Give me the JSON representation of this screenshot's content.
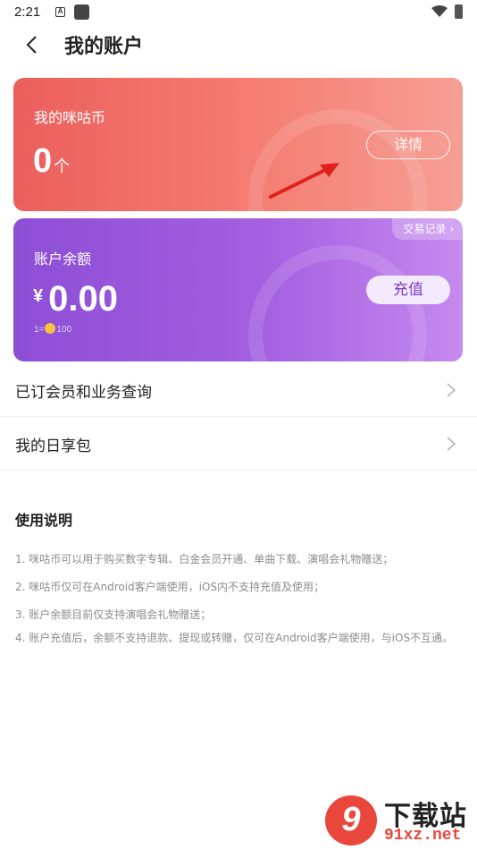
{
  "status_bar": {
    "time": "2:21",
    "notification_letter": "A"
  },
  "header": {
    "title": "我的账户"
  },
  "coin_card": {
    "label": "我的咪咕币",
    "amount": "0",
    "unit": "个",
    "detail_button": "详情"
  },
  "balance_card": {
    "transactions_link": "交易记录 ›",
    "label": "账户余额",
    "currency_symbol": "¥",
    "amount": "0.00",
    "rate_left": "1=",
    "rate_right": "100",
    "recharge_button": "充值"
  },
  "menu": {
    "items": [
      {
        "label": "已订会员和业务查询"
      },
      {
        "label": "我的日享包"
      }
    ]
  },
  "instructions": {
    "title": "使用说明",
    "notes": [
      "1. 咪咕币可以用于购买数字专辑、白金会员开通、单曲下载、演唱会礼物赠送；",
      "2. 咪咕币仅可在Android客户端使用，iOS内不支持充值及使用；",
      "3. 账户余额目前仅支持演唱会礼物赠送；",
      "4. 账户充值后，余额不支持退款、提现或转赠，仅可在Android客户端使用，与iOS不互通。"
    ]
  },
  "site_watermark": {
    "badge": "9",
    "name": "下载站",
    "url": "91xz.net"
  },
  "colors": {
    "coin_card_start": "#ec5f5c",
    "balance_card_start": "#8d4ed6",
    "annotation_arrow": "#e0201c",
    "site_red": "#e9473c"
  }
}
